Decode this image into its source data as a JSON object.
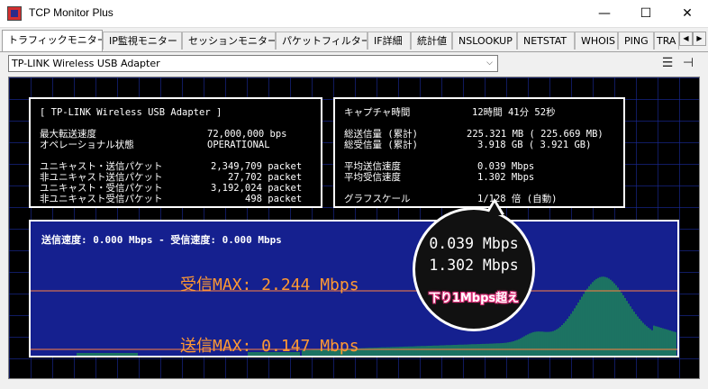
{
  "window": {
    "title": "TCP Monitor Plus",
    "minimize": "—",
    "maximize": "☐",
    "close": "✕"
  },
  "tabs": [
    {
      "label": "トラフィックモニター",
      "active": true
    },
    {
      "label": "IP監視モニター"
    },
    {
      "label": "セッションモニター"
    },
    {
      "label": "パケットフィルター"
    },
    {
      "label": "IF詳細"
    },
    {
      "label": "統計値"
    },
    {
      "label": "NSLOOKUP"
    },
    {
      "label": "NETSTAT"
    },
    {
      "label": "WHOIS"
    },
    {
      "label": "PING"
    },
    {
      "label": "TRA"
    }
  ],
  "tab_scroll": {
    "left": "◀",
    "right": "▶"
  },
  "adapter_select": {
    "value": "TP-LINK Wireless USB Adapter",
    "arrow": "⌵"
  },
  "toolbar": {
    "list_icon": "☰",
    "pin_icon": "⊣"
  },
  "adapter_info": {
    "header": "[ TP-LINK Wireless USB Adapter ]",
    "rows": [
      {
        "label": "最大転送速度",
        "value": "72,000,000 bps"
      },
      {
        "label": "オペレーショナル状態",
        "value": "OPERATIONAL"
      },
      {
        "label": "",
        "value": ""
      },
      {
        "label": "ユニキャスト・送信パケット",
        "value": "2,349,709 packet"
      },
      {
        "label": "非ユニキャスト送信パケット",
        "value": "27,702 packet"
      },
      {
        "label": "ユニキャスト・受信パケット",
        "value": "3,192,024 packet"
      },
      {
        "label": "非ユニキャスト受信パケット",
        "value": "498 packet"
      }
    ]
  },
  "capture_info": {
    "rows": [
      {
        "label": "キャプチャ時間",
        "value": "12時間 41分 52秒"
      },
      {
        "label": "",
        "value": ""
      },
      {
        "label": "総送信量 (累計)",
        "value": "225.321 MB ( 225.669 MB)"
      },
      {
        "label": "総受信量 (累計)",
        "value": "3.918 GB (   3.921 GB)"
      },
      {
        "label": "",
        "value": ""
      },
      {
        "label": "平均送信速度",
        "value": "0.039 Mbps"
      },
      {
        "label": "平均受信速度",
        "value": "1.302 Mbps"
      },
      {
        "label": "",
        "value": ""
      },
      {
        "label": "グラフスケール",
        "value": "1/128 倍 (自動)"
      }
    ]
  },
  "graph": {
    "speed_text": "送信速度:  0.000 Mbps  -  受信速度:  0.000 Mbps",
    "rx_max": "受信MAX:   2.244 Mbps",
    "tx_max": "送信MAX:   0.147 Mbps",
    "colors": {
      "background": "#15208f",
      "bars": "#22aa44",
      "max_line": "#ff8040",
      "text_max": "#ff9933"
    }
  },
  "callout": {
    "line1": "0.039 Mbps",
    "line2": "1.302 Mbps",
    "note": "下り1Mbps超え"
  }
}
